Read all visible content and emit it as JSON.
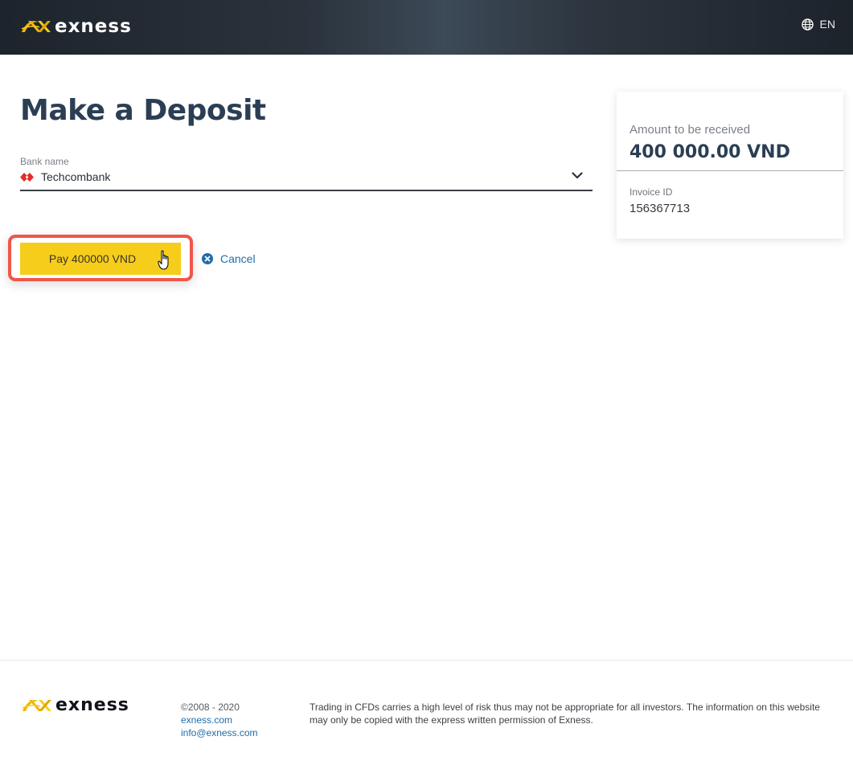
{
  "header": {
    "brand": "exness",
    "language": "EN",
    "icons": {
      "logo": "exness-logo-icon",
      "language": "globe-icon"
    }
  },
  "page": {
    "title": "Make a Deposit"
  },
  "form": {
    "bank_field": {
      "label": "Bank name",
      "value": "Techcombank",
      "icon": "techcombank-logo-icon"
    },
    "pay_button_label": "Pay 400000 VND",
    "cancel_label": "Cancel"
  },
  "summary": {
    "amount_label": "Amount to be received",
    "amount_value": "400 000.00 VND",
    "invoice_label": "Invoice ID",
    "invoice_value": "156367713"
  },
  "footer": {
    "brand": "exness",
    "copyright": "©2008 - 2020",
    "site_link": "exness.com",
    "email_link": "info@exness.com",
    "disclaimer": "Trading in CFDs carries a high level of risk thus may not be appropriate for all investors. The information on this website may only be copied with the express written permission of Exness."
  },
  "colors": {
    "accent_yellow": "#f7cd1b",
    "highlight_red": "#f0564a",
    "link_blue": "#1e6cab",
    "title_navy": "#2b3e54"
  }
}
